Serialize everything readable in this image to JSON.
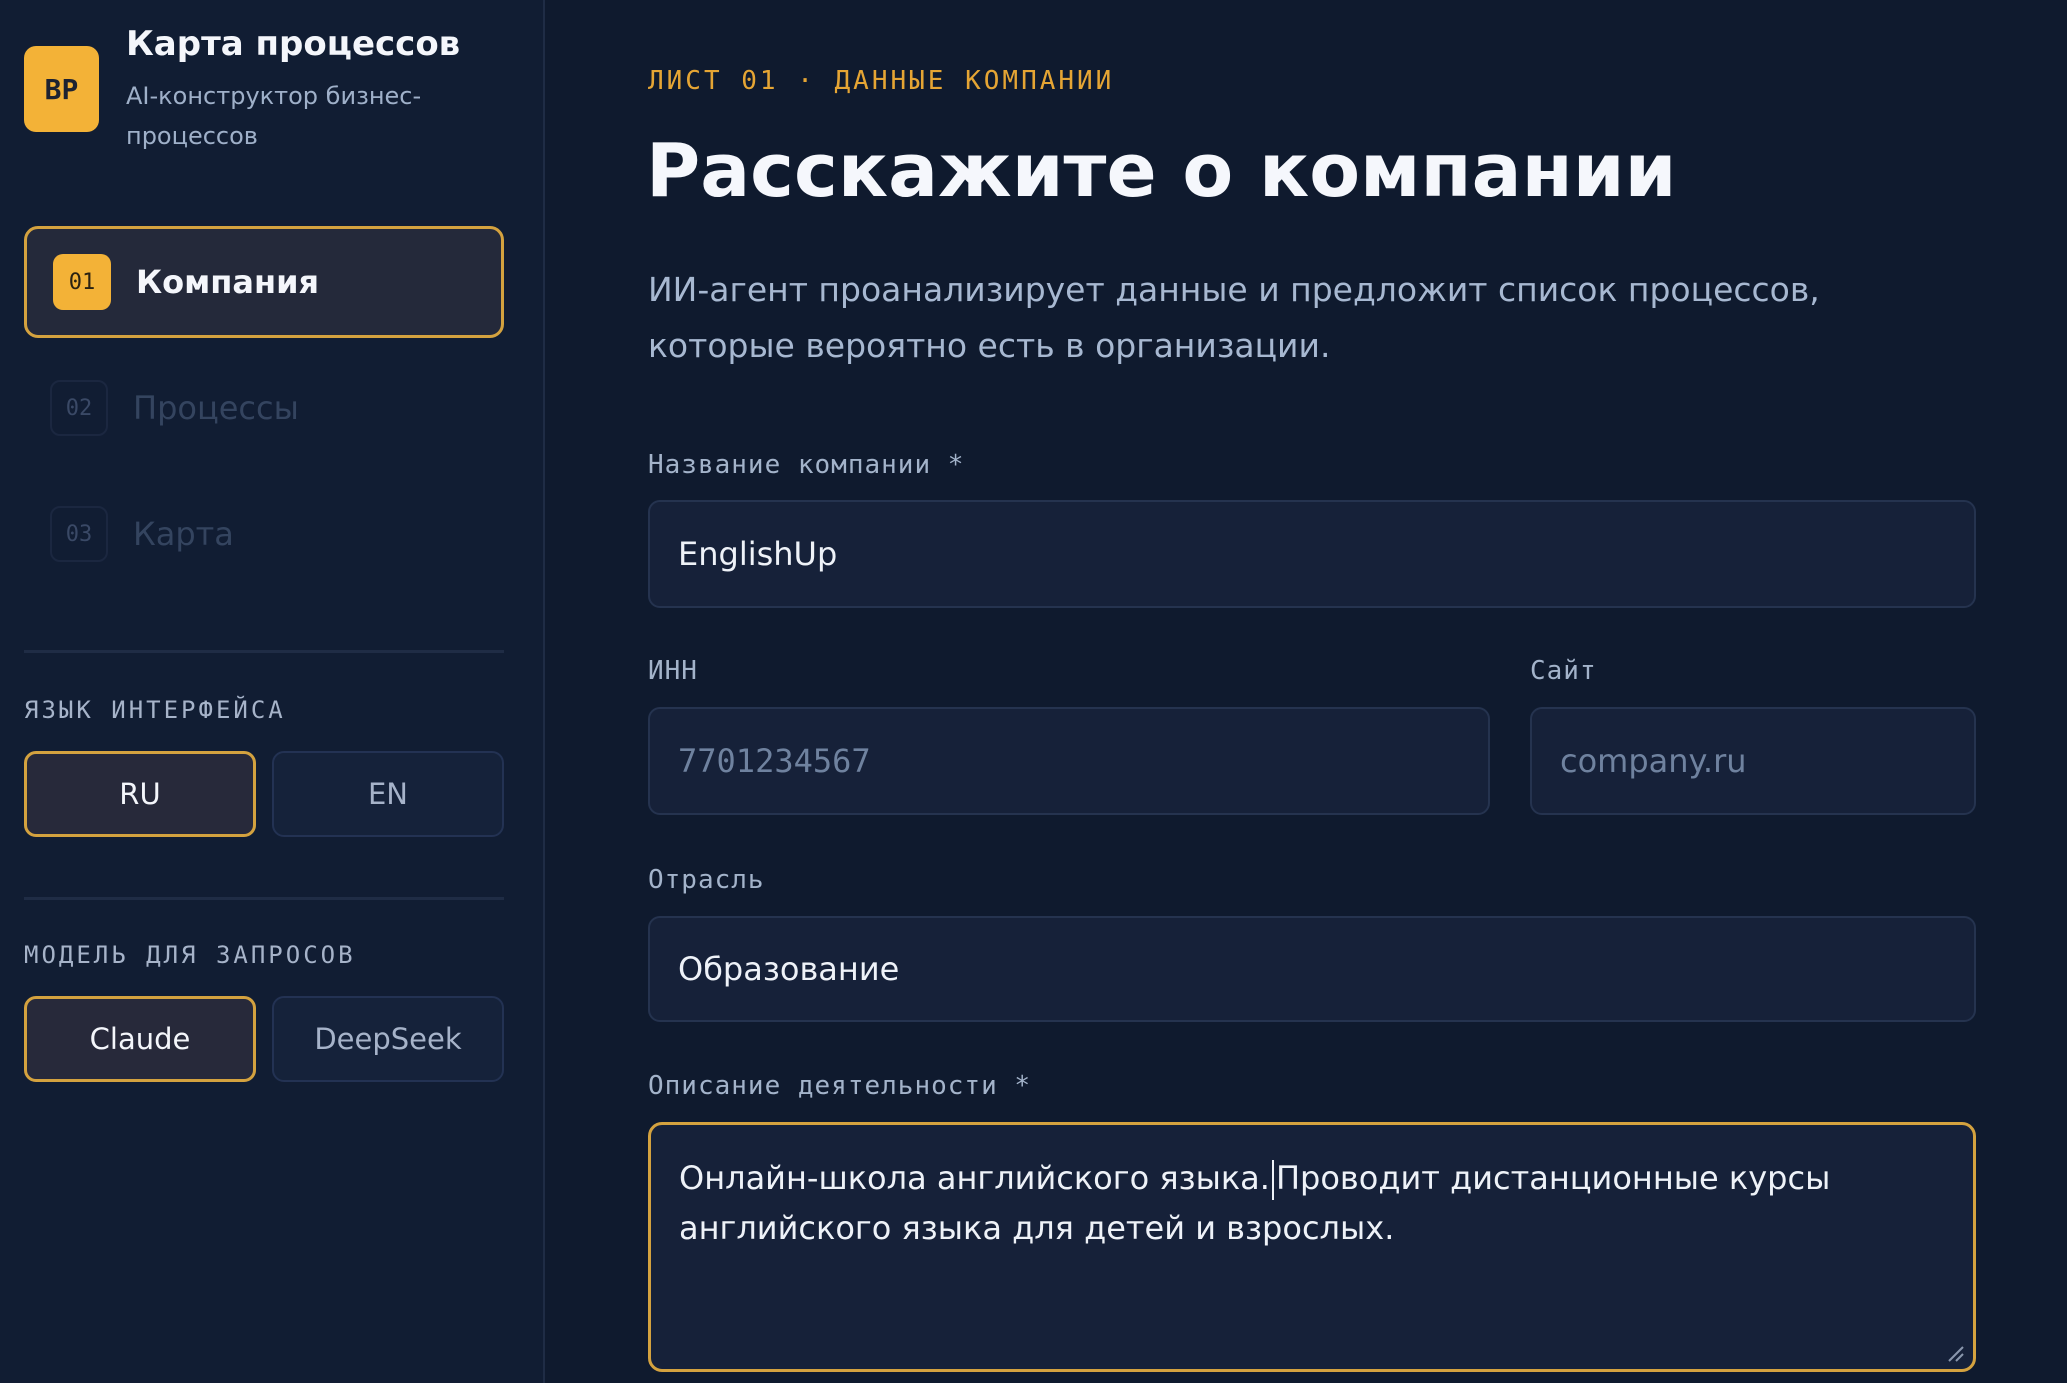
{
  "brand": {
    "logo_text": "BP",
    "title": "Карта процессов",
    "subtitle": "AI-конструктор бизнес-процессов"
  },
  "nav": {
    "items": [
      {
        "num": "01",
        "label": "Компания",
        "active": true
      },
      {
        "num": "02",
        "label": "Процессы",
        "active": false
      },
      {
        "num": "03",
        "label": "Карта",
        "active": false
      }
    ]
  },
  "language": {
    "title": "ЯЗЫК ИНТЕРФЕЙСА",
    "options": [
      "RU",
      "EN"
    ],
    "selected": "RU"
  },
  "model": {
    "title": "МОДЕЛЬ ДЛЯ ЗАПРОСОВ",
    "options": [
      "Claude",
      "DeepSeek"
    ],
    "selected": "Claude"
  },
  "main": {
    "kicker": "ЛИСТ 01 · ДАННЫЕ КОМПАНИИ",
    "title": "Расскажите о компании",
    "lead": "ИИ-агент проанализирует данные и предложит список процессов, которые вероятно есть в организации."
  },
  "form": {
    "company_name": {
      "label": "Название компании *",
      "value": "EnglishUp"
    },
    "inn": {
      "label": "ИНН",
      "placeholder": "7701234567"
    },
    "site": {
      "label": "Сайт",
      "placeholder": "company.ru"
    },
    "industry": {
      "label": "Отрасль",
      "value": "Образование"
    },
    "description": {
      "label": "Описание деятельности *",
      "value_before_caret": "Онлайн-школа английского языка.",
      "value_after_caret": "Проводит дистанционные курсы английского языка для детей и взрослых."
    }
  },
  "colors": {
    "accent": "#f3b237",
    "background": "#0f1a2e",
    "sidebar": "#111d33"
  }
}
